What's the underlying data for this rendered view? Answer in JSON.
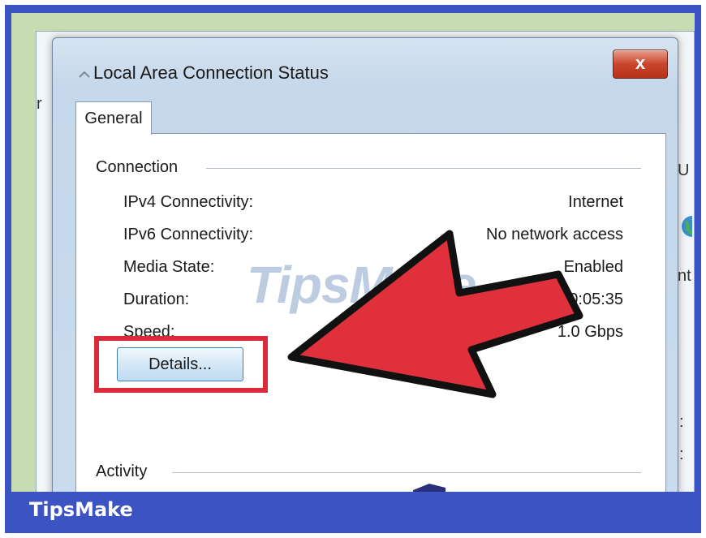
{
  "window": {
    "title": "Local Area Connection Status",
    "close_label": "x"
  },
  "tabs": [
    {
      "label": "General"
    }
  ],
  "connection": {
    "group_label": "Connection",
    "rows": [
      {
        "label": "IPv4 Connectivity:",
        "value": "Internet"
      },
      {
        "label": "IPv6 Connectivity:",
        "value": "No network access"
      },
      {
        "label": "Media State:",
        "value": "Enabled"
      },
      {
        "label": "Duration:",
        "value": "00:05:35"
      },
      {
        "label": "Speed:",
        "value": "1.0 Gbps"
      }
    ],
    "details_label": "Details..."
  },
  "activity": {
    "group_label": "Activity"
  },
  "watermark": "TipsMake",
  "brand": "TipsMake",
  "behind": {
    "fragments": [
      "U",
      "nt",
      ":",
      ":",
      "r"
    ]
  },
  "colors": {
    "frame": "#3c53c3",
    "highlight": "#d92b3a",
    "arrow": "#e0303c"
  }
}
